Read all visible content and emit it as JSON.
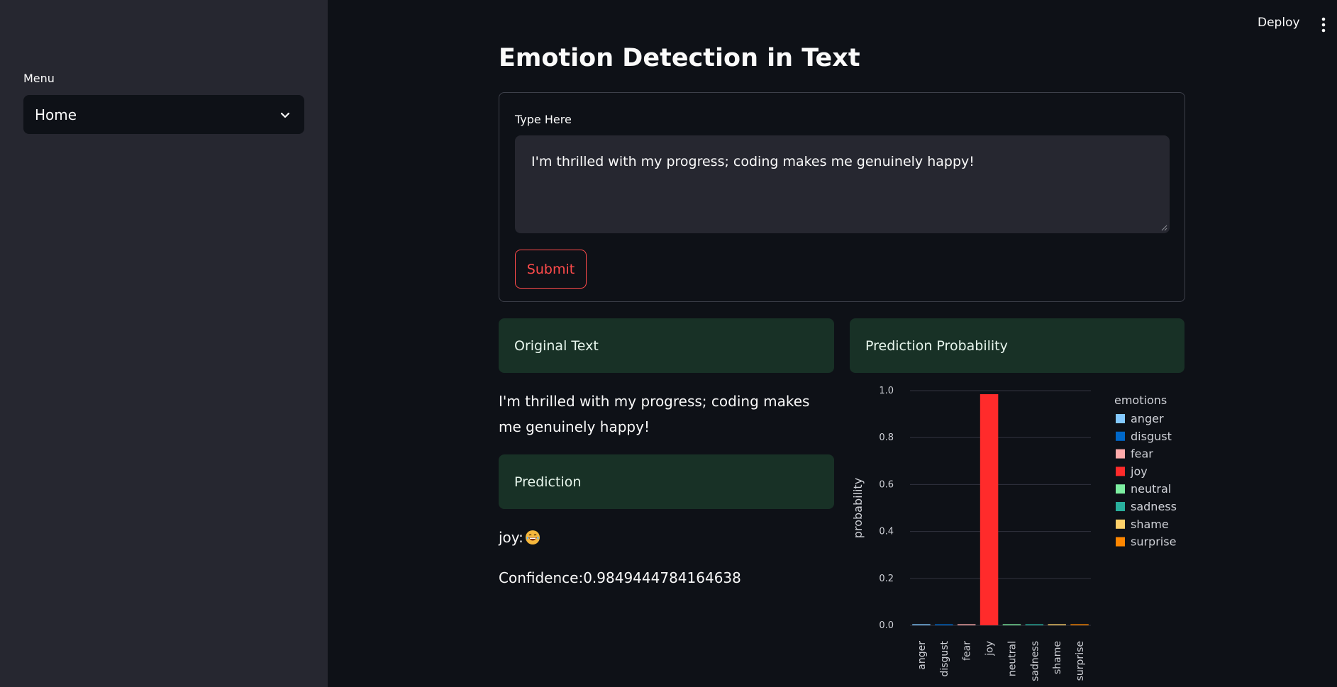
{
  "sidebar": {
    "menu_label": "Menu",
    "select_value": "Home"
  },
  "header": {
    "deploy_label": "Deploy"
  },
  "main": {
    "title": "Emotion Detection in Text",
    "form": {
      "field_label": "Type Here",
      "text_value": "I'm thrilled with my progress; coding makes me genuinely happy!",
      "submit_label": "Submit"
    },
    "original_text_header": "Original Text",
    "original_text": "I'm thrilled with my progress; coding makes me genuinely happy!",
    "prediction_header": "Prediction",
    "prediction_label": "joy:",
    "prediction_emoji_icon": "grinning-tears-emoji",
    "confidence_text": "Confidence:0.9849444784164638",
    "probability_header": "Prediction Probability"
  },
  "colors": {
    "accent": "#ff4b4b",
    "sidebar_bg": "#262730",
    "app_bg": "#0e1117",
    "success_box_bg": "#183126"
  },
  "chart_data": {
    "type": "bar",
    "categories": [
      "anger",
      "disgust",
      "fear",
      "joy",
      "neutral",
      "sadness",
      "shame",
      "surprise"
    ],
    "values": [
      0.002,
      0.003,
      0.003,
      0.985,
      0.0,
      0.004,
      0.0,
      0.003
    ],
    "colors": [
      "#83c9ff",
      "#0068c9",
      "#ffabab",
      "#ff2b2b",
      "#7defa1",
      "#29b09d",
      "#ffd16a",
      "#ff8700"
    ],
    "ylabel": "probability",
    "xlabel": "",
    "ylim": [
      0,
      1.0
    ],
    "yticks": [
      "0.0",
      "0.2",
      "0.4",
      "0.6",
      "0.8",
      "1.0"
    ],
    "legend_title": "emotions",
    "legend_position": "right",
    "grid": true
  }
}
